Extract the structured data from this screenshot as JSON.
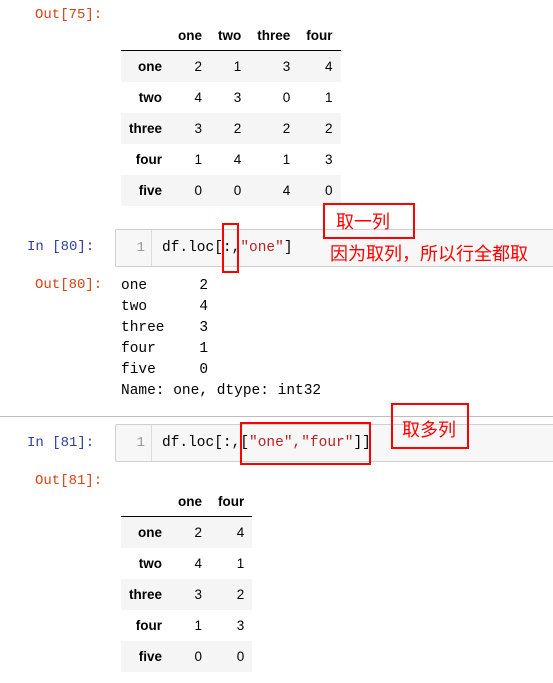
{
  "cells": [
    {
      "out_prompt": "Out[75]:",
      "table": {
        "columns": [
          "one",
          "two",
          "three",
          "four"
        ],
        "rows": [
          {
            "index": "one",
            "values": [
              "2",
              "1",
              "3",
              "4"
            ]
          },
          {
            "index": "two",
            "values": [
              "4",
              "3",
              "0",
              "1"
            ]
          },
          {
            "index": "three",
            "values": [
              "3",
              "2",
              "2",
              "2"
            ]
          },
          {
            "index": "four",
            "values": [
              "1",
              "4",
              "1",
              "3"
            ]
          },
          {
            "index": "five",
            "values": [
              "0",
              "0",
              "4",
              "0"
            ]
          }
        ]
      }
    },
    {
      "in_prompt": "In  [80]:",
      "line_number": "1",
      "code_prefix": "df.loc[:,",
      "code_string": "\"one\"",
      "code_suffix": "]",
      "out_prompt": "Out[80]:",
      "output_lines": [
        "one      2",
        "two      4",
        "three    3",
        "four     1",
        "five     0",
        "Name: one, dtype: int32"
      ],
      "annotations": [
        "取一列",
        "因为取列，所以行全都取"
      ]
    },
    {
      "in_prompt": "In  [81]:",
      "line_number": "1",
      "code_prefix": "df.loc[:,[",
      "code_string": "\"one\",\"four\"",
      "code_suffix": "]]",
      "out_prompt": "Out[81]:",
      "annotations": [
        "取多列"
      ],
      "table": {
        "columns": [
          "one",
          "four"
        ],
        "rows": [
          {
            "index": "one",
            "values": [
              "2",
              "4"
            ]
          },
          {
            "index": "two",
            "values": [
              "4",
              "1"
            ]
          },
          {
            "index": "three",
            "values": [
              "3",
              "2"
            ]
          },
          {
            "index": "four",
            "values": [
              "1",
              "3"
            ]
          },
          {
            "index": "five",
            "values": [
              "0",
              "0"
            ]
          }
        ]
      }
    }
  ],
  "colors": {
    "out_prompt": "#D84315",
    "in_prompt": "#303F9F",
    "string": "#BA2121",
    "annotation": "#FF0000"
  }
}
